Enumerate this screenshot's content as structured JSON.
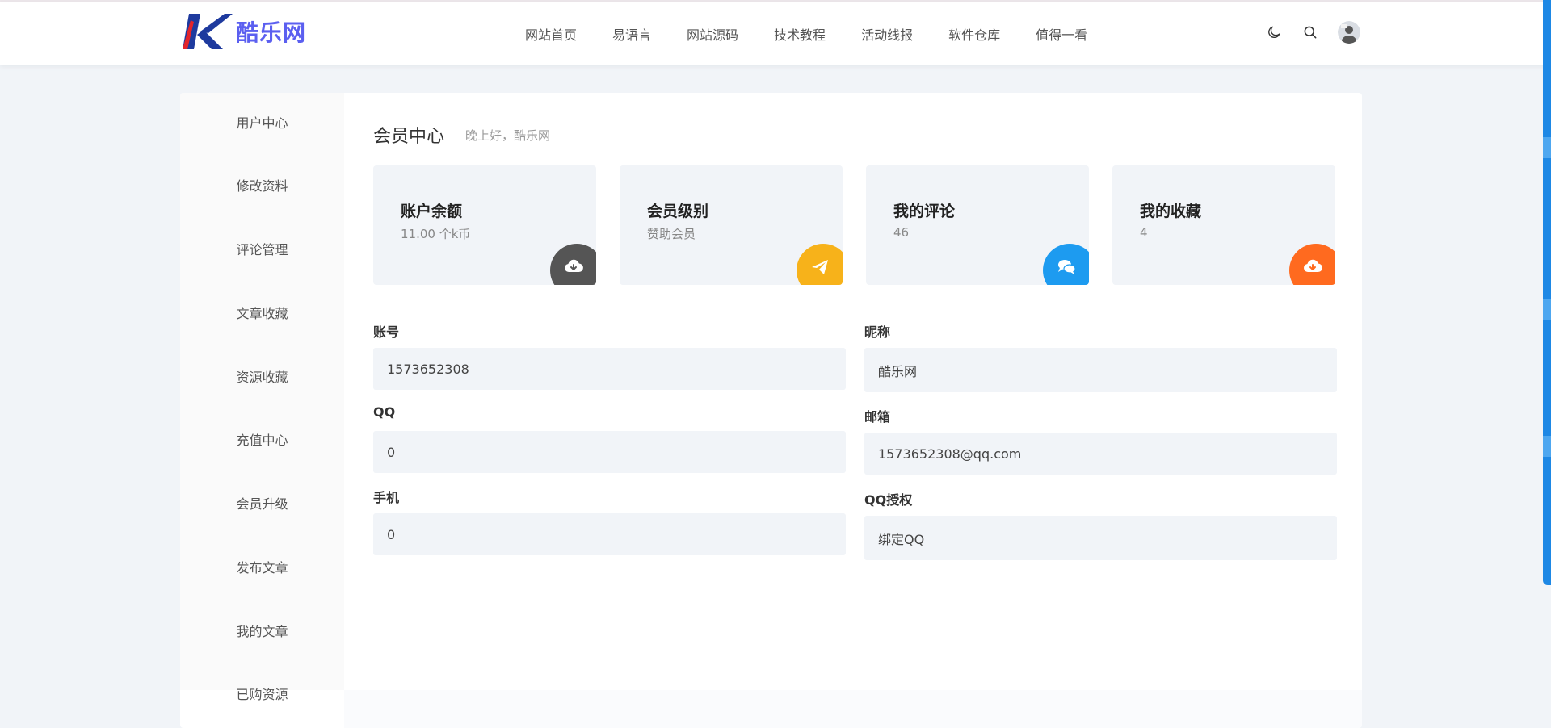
{
  "site": {
    "logo_text": "酷乐网"
  },
  "nav": [
    "网站首页",
    "易语言",
    "网站源码",
    "技术教程",
    "活动线报",
    "软件仓库",
    "值得一看"
  ],
  "sidebar": [
    "用户中心",
    "修改资料",
    "评论管理",
    "文章收藏",
    "资源收藏",
    "充值中心",
    "会员升级",
    "发布文章",
    "我的文章",
    "已购资源"
  ],
  "main": {
    "title": "会员中心",
    "greeting": "晚上好，酷乐网"
  },
  "cards": [
    {
      "title": "账户余额",
      "value": "11.00 个k币",
      "icon": "cloud-download-icon",
      "color": "#555555"
    },
    {
      "title": "会员级别",
      "value": "赞助会员",
      "icon": "paper-plane-icon",
      "color": "#f7b21a"
    },
    {
      "title": "我的评论",
      "value": "46",
      "icon": "chat-bubbles-icon",
      "color": "#1d9bf0"
    },
    {
      "title": "我的收藏",
      "value": "4",
      "icon": "cloud-download-icon",
      "color": "#ff6a1f"
    }
  ],
  "form": {
    "account_label": "账号",
    "account_value": "1573652308",
    "nickname_label": "昵称",
    "nickname_value": "酷乐网",
    "qq_label": "QQ",
    "qq_value": "0",
    "email_label": "邮箱",
    "email_value": "1573652308@qq.com",
    "phone_label": "手机",
    "phone_value": "0",
    "qqauth_label": "QQ授权",
    "qqauth_value": "绑定QQ"
  }
}
